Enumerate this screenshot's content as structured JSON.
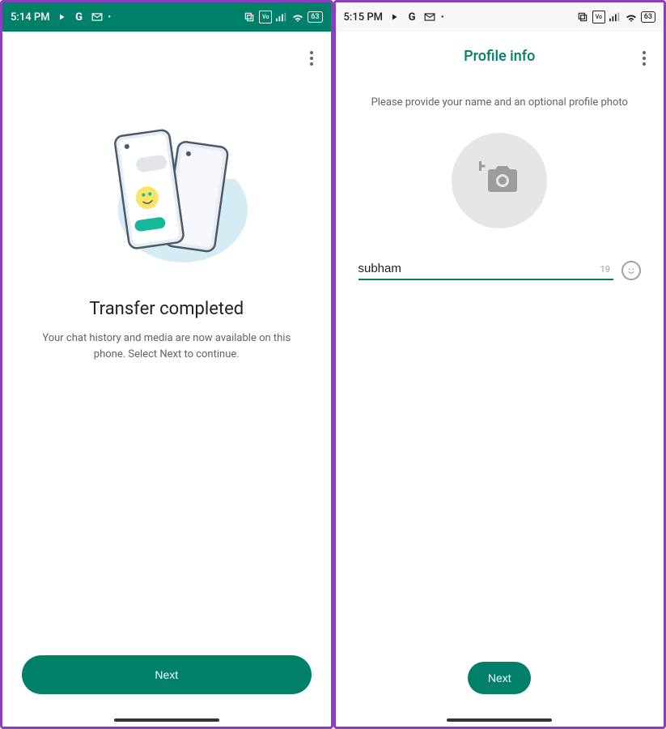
{
  "left": {
    "statusbar": {
      "time": "5:14 PM",
      "battery": "63"
    },
    "title": "Transfer completed",
    "subtitle": "Your chat history and media are now available on this phone. Select Next to continue.",
    "next_label": "Next"
  },
  "right": {
    "statusbar": {
      "time": "5:15 PM",
      "battery": "63"
    },
    "header_title": "Profile info",
    "instruction": "Please provide your name and an optional profile photo",
    "name_value": "subham",
    "char_count": "19",
    "next_label": "Next"
  }
}
